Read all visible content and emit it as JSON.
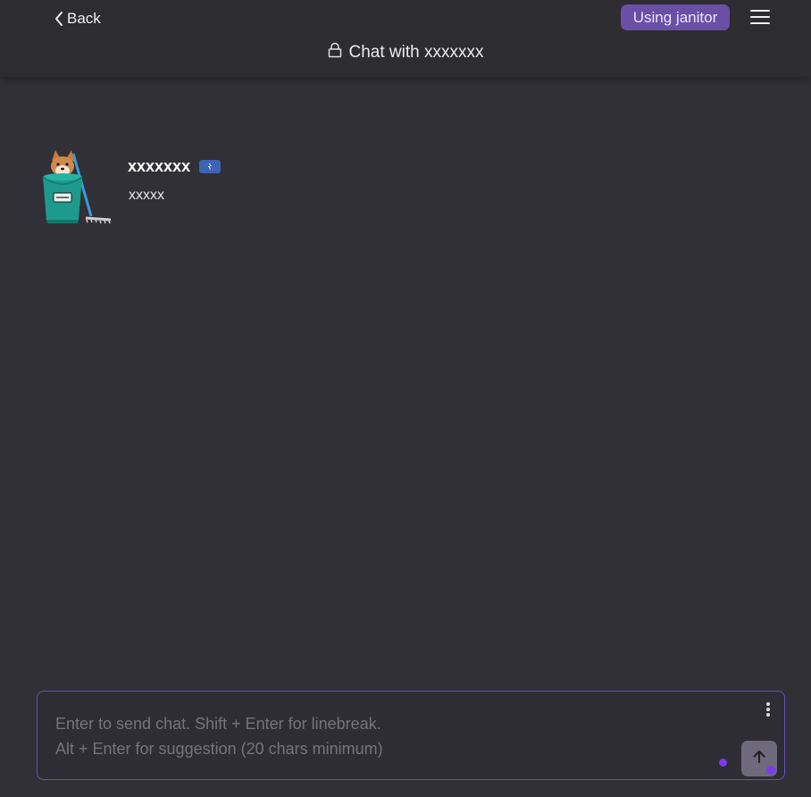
{
  "header": {
    "back_label": "Back",
    "mode_badge": "Using janitor",
    "chat_title": "Chat with xxxxxxx",
    "icons": {
      "back": "chevron-left-icon",
      "menu": "hamburger-menu-icon",
      "lock": "lock-icon"
    }
  },
  "message": {
    "author": "xxxxxxx",
    "text": "xxxxx",
    "avatar": "janitor-dog-bucket-avatar",
    "bot_badge_icon": "bot-badge-icon"
  },
  "composer": {
    "placeholder": "Enter to send chat. Shift + Enter for linebreak.\nAlt + Enter for suggestion (20 chars minimum)",
    "value": "",
    "more_icon": "vertical-dots-icon",
    "send_icon": "arrow-up-icon"
  },
  "colors": {
    "background": "#303036",
    "accent": "#6a4fa6",
    "composer_border": "#6a4fbd",
    "indicator": "#7c3aed"
  }
}
